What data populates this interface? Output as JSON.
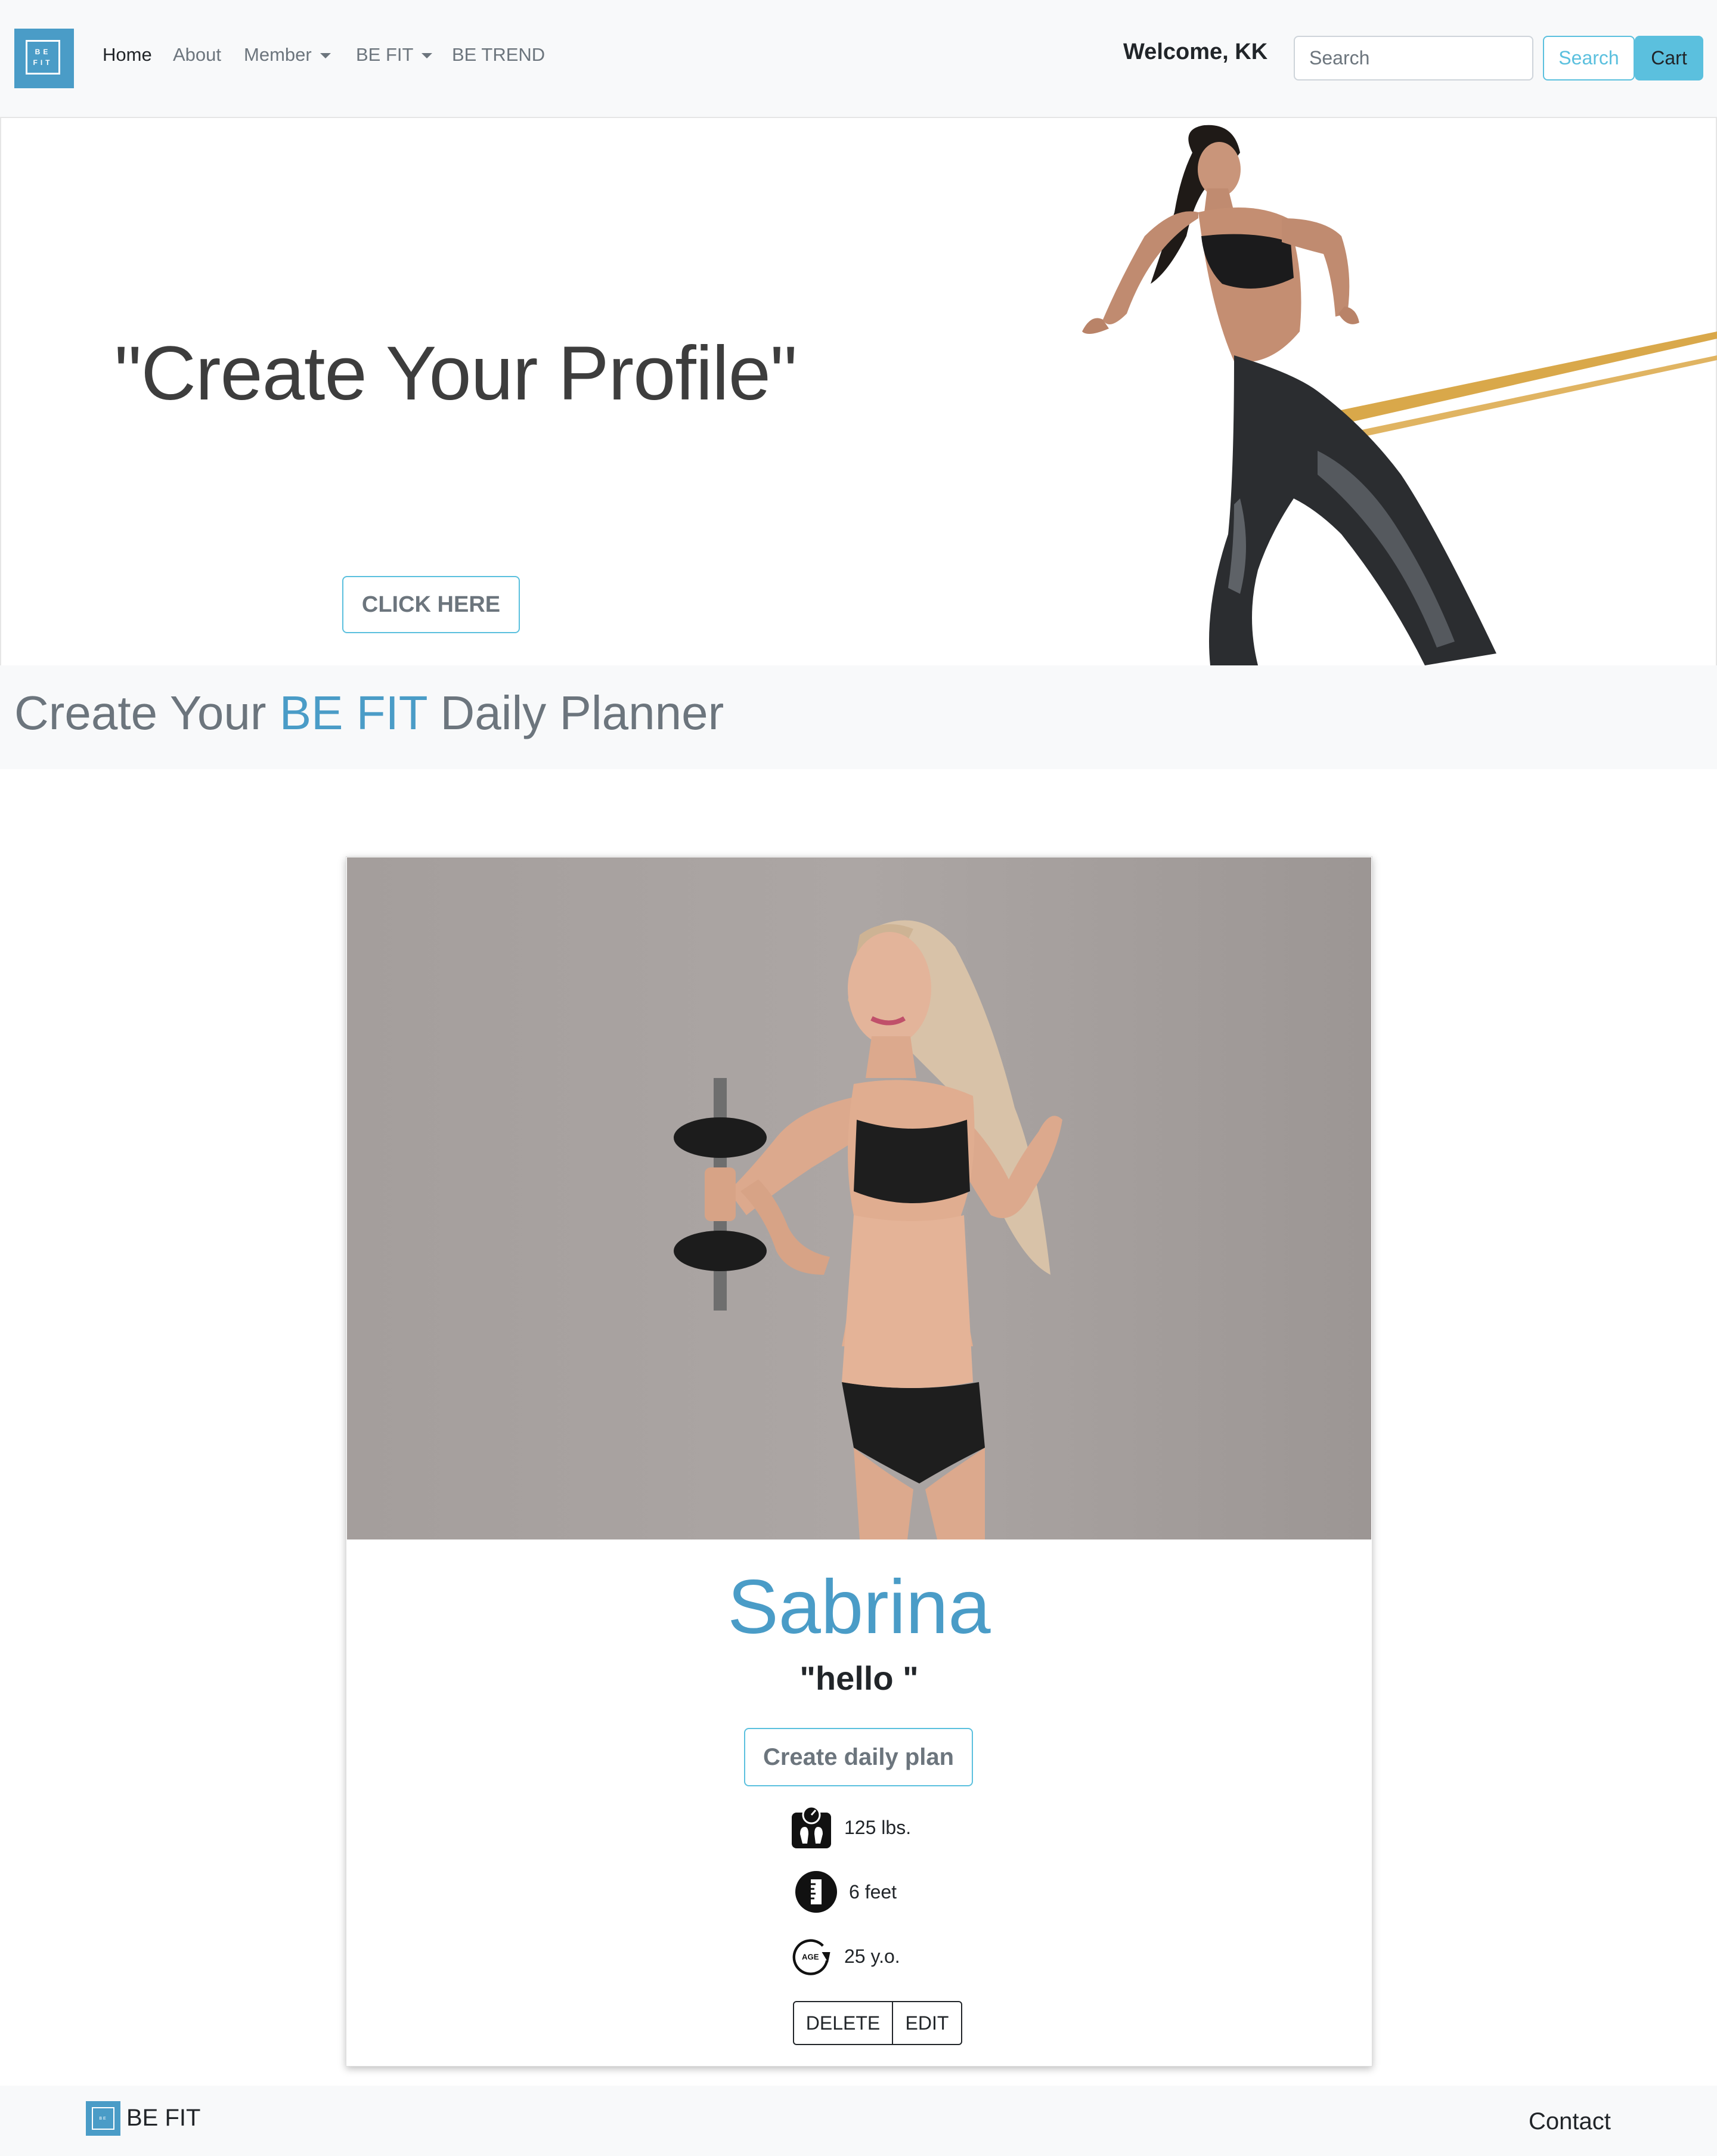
{
  "nav": {
    "logo_line1": "BE",
    "logo_line2": "FIT",
    "links": [
      {
        "label": "Home"
      },
      {
        "label": "About"
      },
      {
        "label": "Member"
      },
      {
        "label": "BE FIT"
      },
      {
        "label": "BE TREND"
      }
    ],
    "welcome": "Welcome, KK",
    "search_placeholder": "Search",
    "search_button": "Search",
    "cart_button": "Cart"
  },
  "hero": {
    "title": "\"Create Your Profile\"",
    "cta": "CLICK HERE"
  },
  "section": {
    "title_prefix": "Create Your ",
    "title_accent": "BE FIT",
    "title_suffix": " Daily Planner"
  },
  "profile": {
    "name": "Sabrina",
    "quote": "\"hello \"",
    "plan_button": "Create daily plan",
    "weight": "125 lbs.",
    "height": "6 feet",
    "age": "25 y.o.",
    "age_icon_text": "AGE",
    "delete_button": "DELETE",
    "edit_button": "EDIT"
  },
  "footer": {
    "brand": "BE FIT",
    "contact": "Contact"
  },
  "colors": {
    "brand": "#4a9cc7",
    "info": "#5bc0de",
    "navbar_bg": "#f8f9fa"
  }
}
